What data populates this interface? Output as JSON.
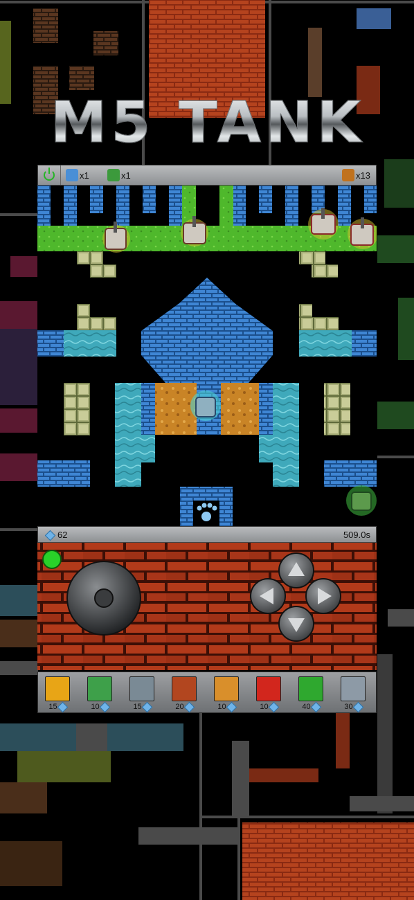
{
  "game": {
    "title": "M5 TANK"
  },
  "top_bar": {
    "power_icon": "power-icon",
    "player_tanks": [
      {
        "icon": "blue-tank-icon",
        "count": "x1",
        "color": "#4a8fd6"
      },
      {
        "icon": "green-tank-icon",
        "count": "x1",
        "color": "#3c9a3c"
      }
    ],
    "enemy": {
      "icon": "enemy-tank-icon",
      "count": "x13",
      "color": "#c0721e"
    }
  },
  "status_bar": {
    "gems": "62",
    "timer": "509.0s"
  },
  "controls": {
    "joystick": "joystick",
    "dpad": [
      "up",
      "left",
      "right",
      "down"
    ],
    "indicator_color": "#29d129"
  },
  "powerups": [
    {
      "name": "speed-up",
      "cost": "15",
      "color": "#e8a516"
    },
    {
      "name": "shield",
      "cost": "10",
      "color": "#3ea04a"
    },
    {
      "name": "airstrike",
      "cost": "15",
      "color": "#7a8a95"
    },
    {
      "name": "missile",
      "cost": "20",
      "color": "#b2461f"
    },
    {
      "name": "armor",
      "cost": "10",
      "color": "#d98f2b"
    },
    {
      "name": "fire",
      "cost": "10",
      "color": "#d2261d"
    },
    {
      "name": "laser",
      "cost": "40",
      "color": "#2fa82f"
    },
    {
      "name": "turret",
      "cost": "30",
      "color": "#8d9aa6"
    }
  ]
}
